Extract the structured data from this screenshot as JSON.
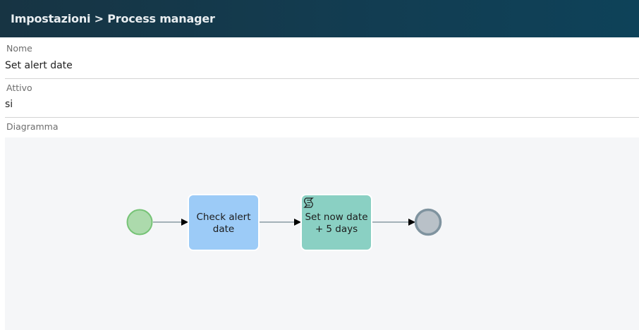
{
  "header": {
    "title": "Impostazioni > Process manager"
  },
  "fields": {
    "nome": {
      "label": "Nome",
      "value": "Set alert date"
    },
    "attivo": {
      "label": "Attivo",
      "value": "si"
    },
    "diagramma": {
      "label": "Diagramma"
    }
  },
  "diagram": {
    "start_event_icon": "circle-start",
    "end_event_icon": "circle-end",
    "tasks": [
      {
        "line1": "Check alert",
        "line2": "date",
        "color": "#9ccbf7",
        "icon": ""
      },
      {
        "line1": "Set now date",
        "line2": "+ 5 days",
        "color": "#8ad0c3",
        "icon": "script-icon"
      }
    ],
    "colors": {
      "start_fill": "#acdaac",
      "start_stroke": "#76c376",
      "end_fill": "#b9c1c8",
      "end_stroke": "#7f939f",
      "flow": "#8a9aa3"
    }
  }
}
